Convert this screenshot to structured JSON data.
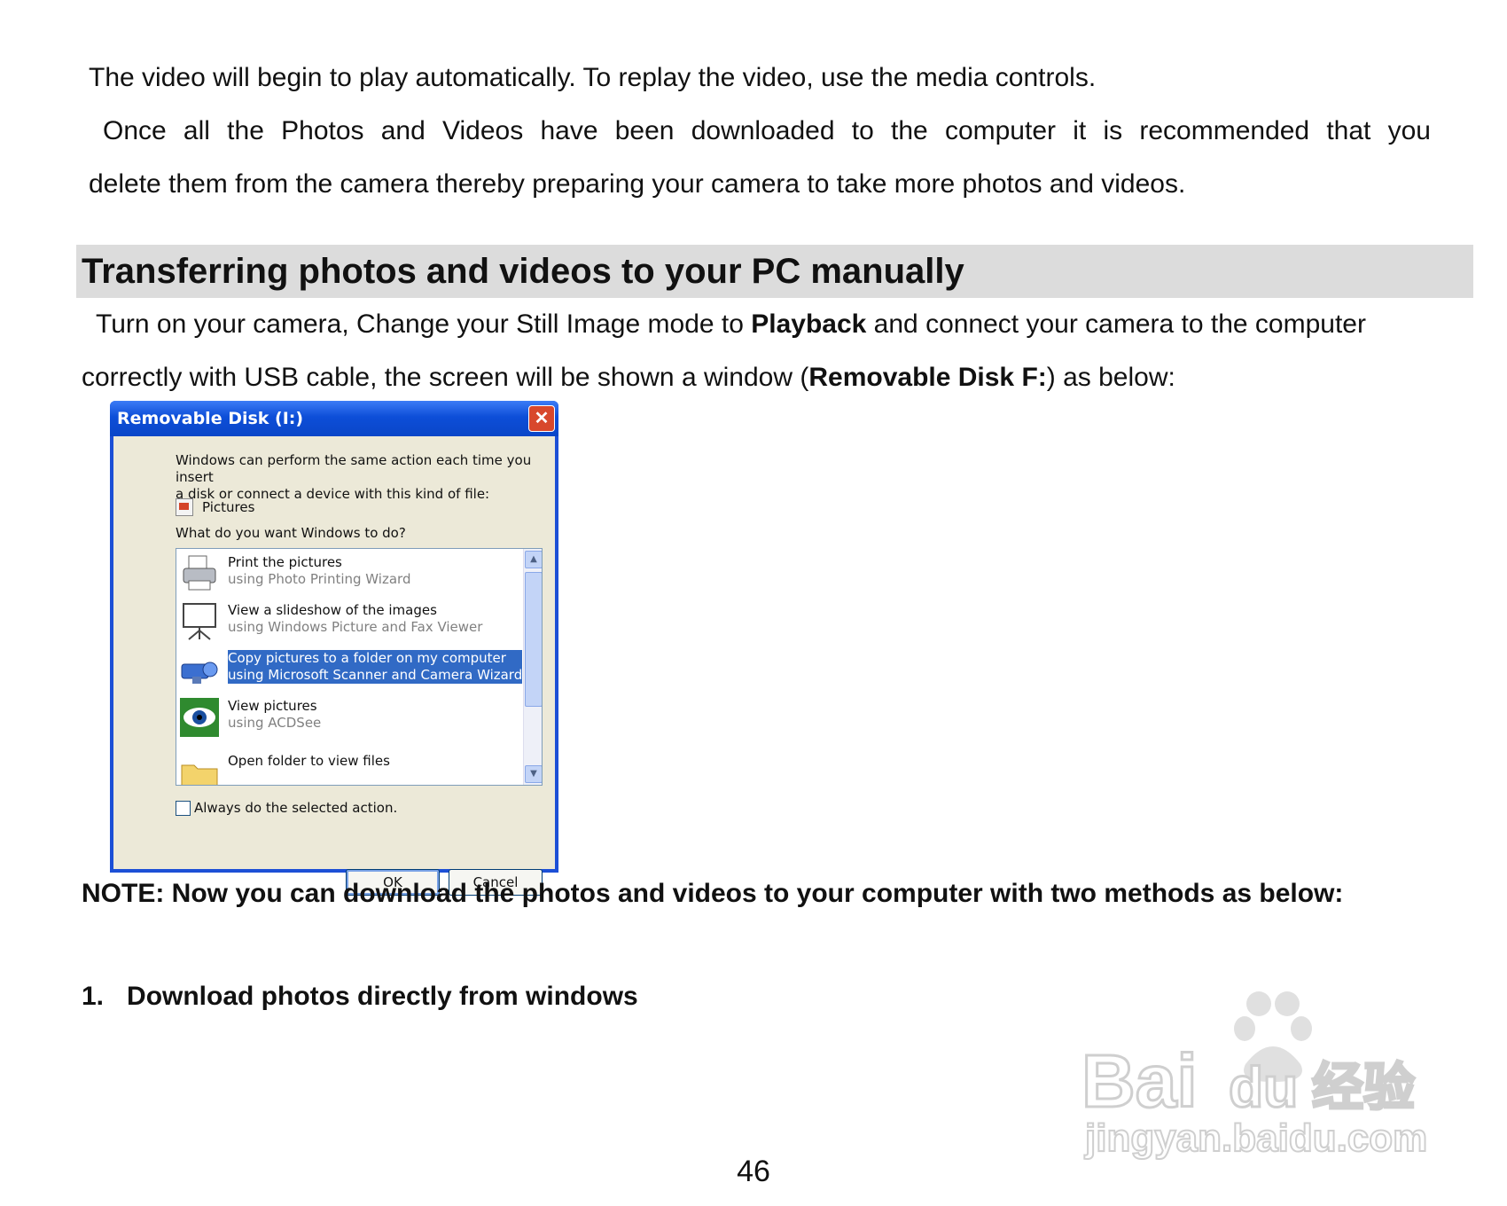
{
  "intro": {
    "line1": "The video will begin to play automatically. To replay the video, use the media controls.",
    "para2_line1": "Once all the Photos and Videos have been downloaded to the computer it is recommended that you",
    "para2_line2": "delete them from the camera thereby preparing your camera to take more photos and videos."
  },
  "section": {
    "heading": "Transferring photos and videos to your PC manually",
    "body_line1_a": "Turn on your camera, Change your Still Image mode to ",
    "body_line1_bold": "Playback",
    "body_line1_b": " and connect your camera to the computer",
    "body_line2_a": "correctly with USB cable, the screen will be shown a window (",
    "body_line2_bold": "Removable Disk F:",
    "body_line2_b": ") as below:"
  },
  "dialog": {
    "title": "Removable Disk (I:)",
    "close_glyph": "✕",
    "desc_line1": "Windows can perform the same action each time you insert",
    "desc_line2": "a disk or connect a device with this kind of file:",
    "file_type": "Pictures",
    "question": "What do you want Windows to do?",
    "options": [
      {
        "title": "Print the pictures",
        "subtitle": "using Photo Printing Wizard",
        "icon": "printer-icon"
      },
      {
        "title": "View a slideshow of the images",
        "subtitle": "using Windows Picture and Fax Viewer",
        "icon": "projector-icon"
      },
      {
        "title": "Copy pictures to a folder on my computer",
        "subtitle": "using Microsoft Scanner and Camera Wizard",
        "icon": "camera-icon",
        "selected": true
      },
      {
        "title": "View pictures",
        "subtitle": "using ACDSee",
        "icon": "eye-icon"
      },
      {
        "title": "Open folder to view files",
        "subtitle": "",
        "icon": "folder-icon"
      }
    ],
    "checkbox_label": "Always do the selected action.",
    "ok_label": "OK",
    "cancel_label": "Cancel"
  },
  "note": "NOTE: Now you can download the photos and videos to your computer with two methods as below:",
  "step1": {
    "number": "1.",
    "text": "Download photos directly from windows"
  },
  "page_number": "46",
  "watermark": {
    "brand": "Baidu",
    "cn": "经验",
    "url": "jingyan.baidu.com"
  },
  "colors": {
    "heading_bar": "#dcdcdc",
    "title_bar": "#0a46c8",
    "selection": "#316ac5"
  }
}
